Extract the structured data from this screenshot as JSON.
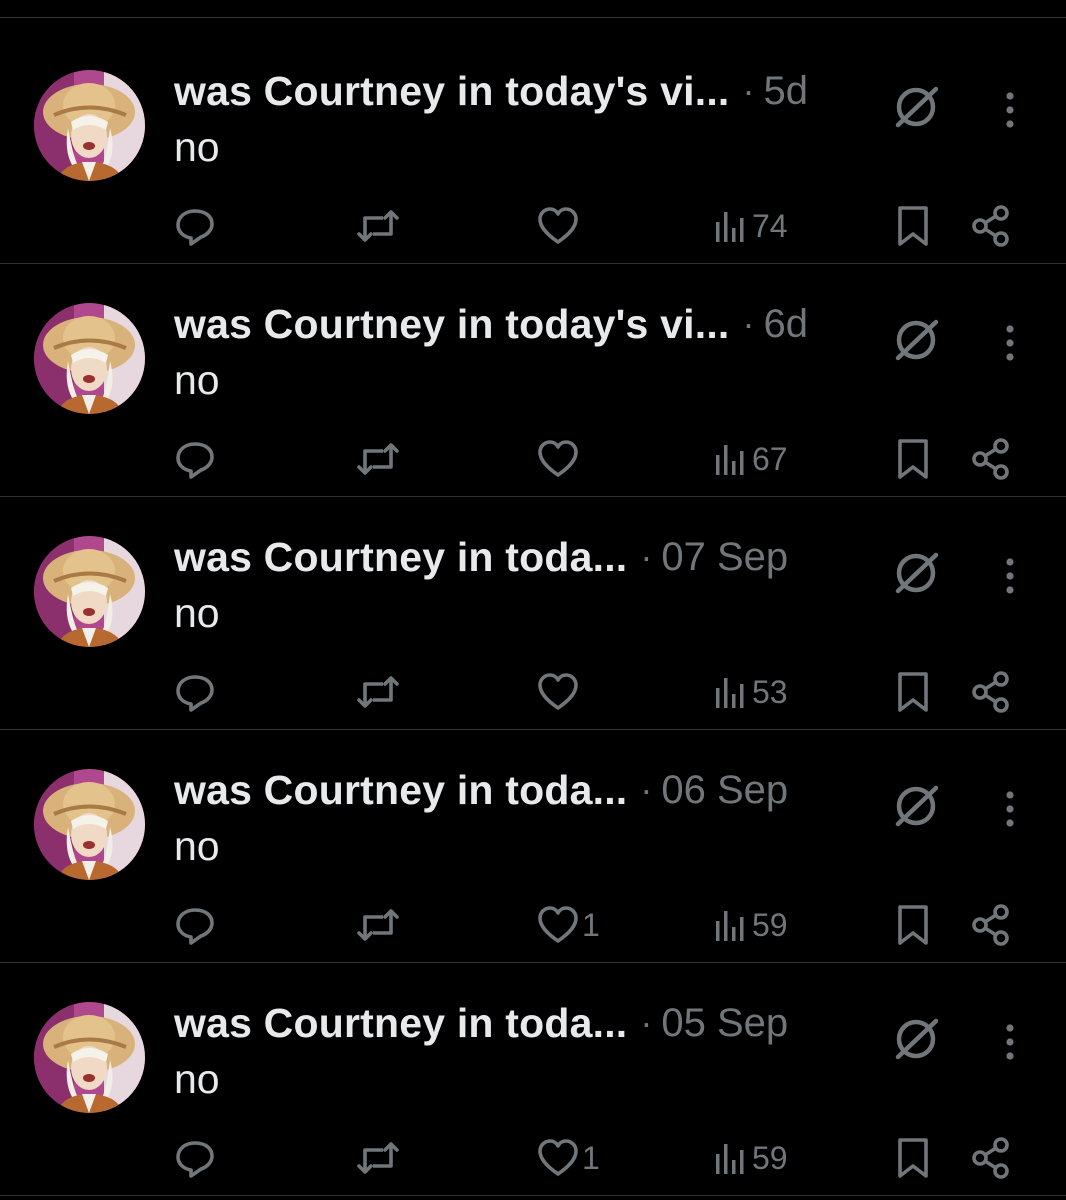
{
  "theme": {
    "background": "#000000",
    "text": "#e7e9ea",
    "muted": "#71767b",
    "divider": "#2f3336"
  },
  "posts": [
    {
      "author": "was Courtney in today's vi...",
      "time": "5d",
      "text": "no",
      "likes": "",
      "views": "74",
      "icons": {
        "reply": "reply-icon",
        "repost": "repost-icon",
        "like": "heart-icon",
        "views": "views-chart-icon",
        "bookmark": "bookmark-icon",
        "share": "share-icon",
        "grok": "grok-icon",
        "more": "more-vertical-icon"
      }
    },
    {
      "author": "was Courtney in today's vi...",
      "time": "6d",
      "text": "no",
      "likes": "",
      "views": "67"
    },
    {
      "author": "was Courtney in toda...",
      "time": "07 Sep",
      "text": "no",
      "likes": "",
      "views": "53"
    },
    {
      "author": "was Courtney in toda...",
      "time": "06 Sep",
      "text": "no",
      "likes": "1",
      "views": "59"
    },
    {
      "author": "was Courtney in toda...",
      "time": "05 Sep",
      "text": "no",
      "likes": "1",
      "views": "59"
    }
  ]
}
